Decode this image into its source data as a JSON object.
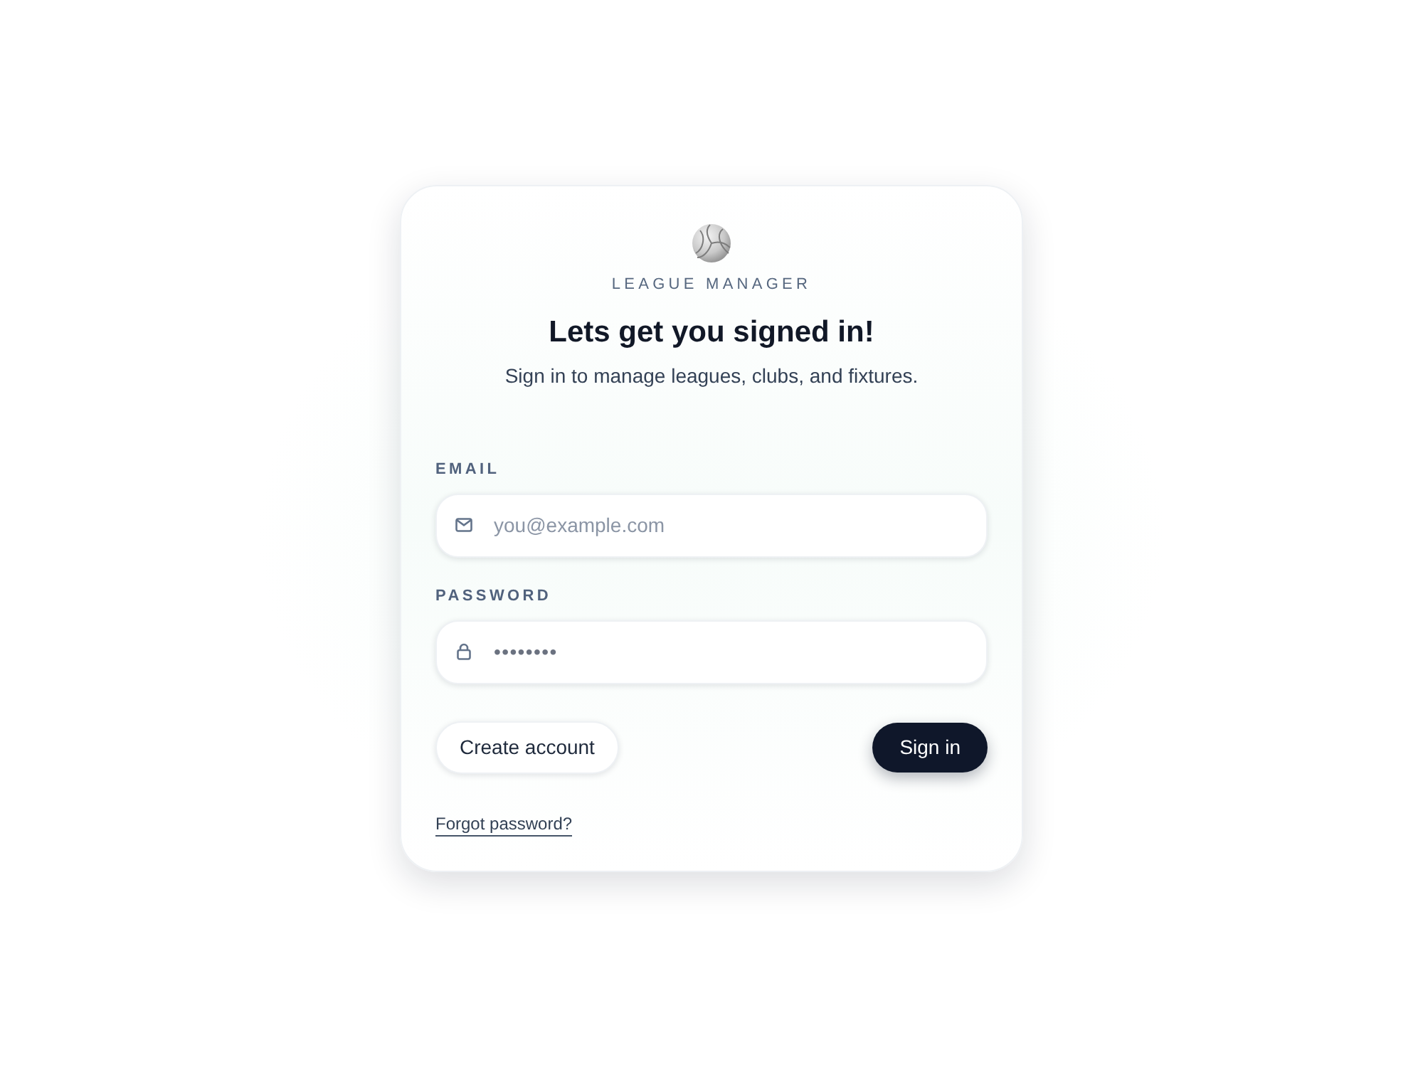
{
  "brand": {
    "name": "LEAGUE MANAGER"
  },
  "heading": {
    "title": "Lets get you signed in!",
    "subtitle": "Sign in to manage leagues, clubs, and fixtures."
  },
  "fields": [
    {
      "kind": "email",
      "label": "EMAIL",
      "placeholder": "you@example.com"
    },
    {
      "kind": "password",
      "label": "PASSWORD",
      "value": "••••••••"
    }
  ],
  "buttons": [
    {
      "kind": "secondary",
      "label": "Create account"
    },
    {
      "kind": "primary",
      "label": "Sign in"
    }
  ],
  "links": [
    {
      "label": "Forgot password?"
    }
  ]
}
